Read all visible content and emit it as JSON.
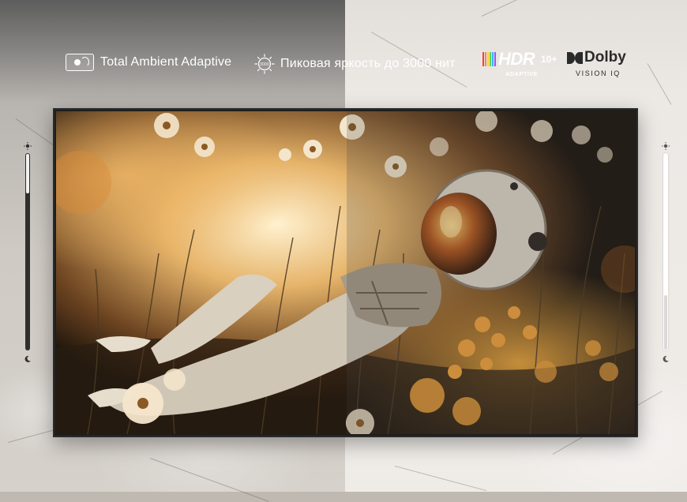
{
  "features": {
    "ambient_label": "Total Ambient Adaptive",
    "brightness_label": "Пиковая яркость до 3000 нит",
    "brightness_icon_text": "3000",
    "hdr_logo_text": "HDR",
    "hdr_logo_suffix": "10+",
    "hdr_logo_sub": "ADAPTIVE",
    "dolby_logo_text": "Dolby",
    "dolby_logo_sub": "VISION IQ"
  },
  "icons": {
    "ambient": "ambient-light-sensor-icon",
    "brightness": "sun-icon",
    "hdr": "hdr10-plus-adaptive-logo",
    "dolby": "dolby-vision-iq-logo",
    "slider_top": "sun-icon",
    "slider_bottom": "moon-icon"
  },
  "sliders": {
    "left_level": 0.2,
    "right_level": 0.28
  },
  "colors": {
    "accent_warm": "#e8a24a",
    "tv_frame": "#1e1e1e",
    "text_light": "#ffffff",
    "text_dark": "#2a2a2a"
  }
}
